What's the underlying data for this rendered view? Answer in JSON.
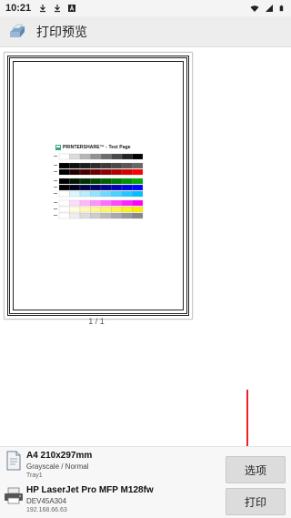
{
  "status_bar": {
    "time": "10:21",
    "left_icons": [
      "download-icon",
      "download-icon",
      "a-box-icon"
    ],
    "right_icons": [
      "wifi-icon",
      "signal-icon",
      "battery-icon"
    ]
  },
  "toolbar": {
    "title": "打印预览",
    "app_icon": "printer-app-icon"
  },
  "preview": {
    "page_title": "PRINTERSHARE™ - Test Page",
    "page_counter": "1 / 1"
  },
  "settings": {
    "paper_size": "A4 210x297mm",
    "color_mode": "Grayscale / Normal",
    "tray": "Tray1",
    "printer_name": "HP LaserJet Pro MFP M128fw",
    "printer_id": "DEV45A304",
    "printer_ip": "192.168.66.63"
  },
  "buttons": {
    "options_label": "选项",
    "print_label": "打印"
  },
  "colors": {
    "accent_arrow": "#ee2222",
    "toolbar_bg": "#ededed",
    "button_bg": "#dcdcdc"
  }
}
